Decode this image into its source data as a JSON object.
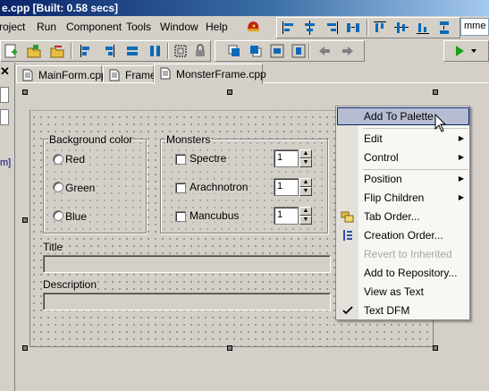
{
  "window": {
    "title": "e.cpp [Built: 0.58 secs]"
  },
  "menu": {
    "items": [
      {
        "label": "roject",
        "name": "menu-project"
      },
      {
        "label": "Run",
        "name": "menu-run"
      },
      {
        "label": "Component",
        "name": "menu-component"
      },
      {
        "label": "Tools",
        "name": "menu-tools"
      },
      {
        "label": "Window",
        "name": "menu-window"
      },
      {
        "label": "Help",
        "name": "menu-help"
      }
    ]
  },
  "search": {
    "value": "mme"
  },
  "left_dock": {
    "label": "m]"
  },
  "tabs": [
    {
      "label": "MainForm.cpp"
    },
    {
      "label": "Frame"
    },
    {
      "label": "MonsterFrame.cpp"
    }
  ],
  "form": {
    "background_group": {
      "caption": "Background color",
      "options": [
        "Red",
        "Green",
        "Blue"
      ]
    },
    "monsters_group": {
      "caption": "Monsters",
      "items": [
        {
          "label": "Spectre",
          "count": "1"
        },
        {
          "label": "Arachnotron",
          "count": "1"
        },
        {
          "label": "Mancubus",
          "count": "1"
        }
      ]
    },
    "title_label": "Title",
    "description_label": "Description"
  },
  "context_menu": {
    "items": [
      {
        "label": "Add To Palette",
        "highlighted": true
      },
      {
        "label": "Edit",
        "submenu": true
      },
      {
        "label": "Control",
        "submenu": true
      },
      {
        "label": "Position",
        "submenu": true
      },
      {
        "label": "Flip Children",
        "submenu": true
      },
      {
        "label": "Tab Order...",
        "icon": "tab-order-icon"
      },
      {
        "label": "Creation Order...",
        "icon": "creation-order-icon"
      },
      {
        "label": "Revert to Inherited",
        "disabled": true
      },
      {
        "label": "Add to Repository..."
      },
      {
        "label": "View as Text"
      },
      {
        "label": "Text DFM",
        "checked": true
      }
    ]
  },
  "colors": {
    "face": "#d4d0c8",
    "title_start": "#0a246a",
    "menu_highlight": "#b6bdd2",
    "link_blue": "#000080"
  }
}
